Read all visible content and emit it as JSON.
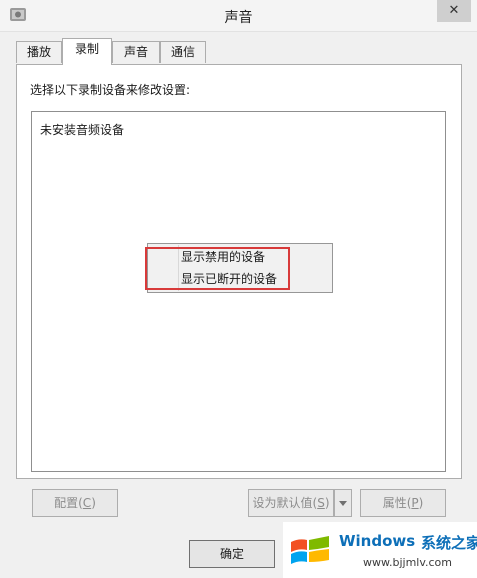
{
  "window": {
    "title": "声音"
  },
  "tabs": [
    {
      "label": "播放"
    },
    {
      "label": "录制"
    },
    {
      "label": "声音"
    },
    {
      "label": "通信"
    }
  ],
  "recording": {
    "instruction": "选择以下录制设备来修改设置:",
    "empty_text": "未安装音频设备"
  },
  "context_menu": {
    "items": [
      {
        "label": "显示禁用的设备"
      },
      {
        "label": "显示已断开的设备"
      }
    ]
  },
  "buttons": {
    "configure": {
      "label": "配置(",
      "key": "C",
      "close": ")"
    },
    "set_default": {
      "label": "设为默认值(",
      "key": "S",
      "close": ")"
    },
    "properties": {
      "label": "属性(",
      "key": "P",
      "close": ")"
    },
    "ok": {
      "label": "确定"
    }
  },
  "watermark": {
    "brand": "Windows",
    "brand_cn": "系统之家",
    "url": "www.bjjmlv.com"
  },
  "colors": {
    "highlight_border": "#d83a3a",
    "brand_blue": "#0d6fb8"
  }
}
